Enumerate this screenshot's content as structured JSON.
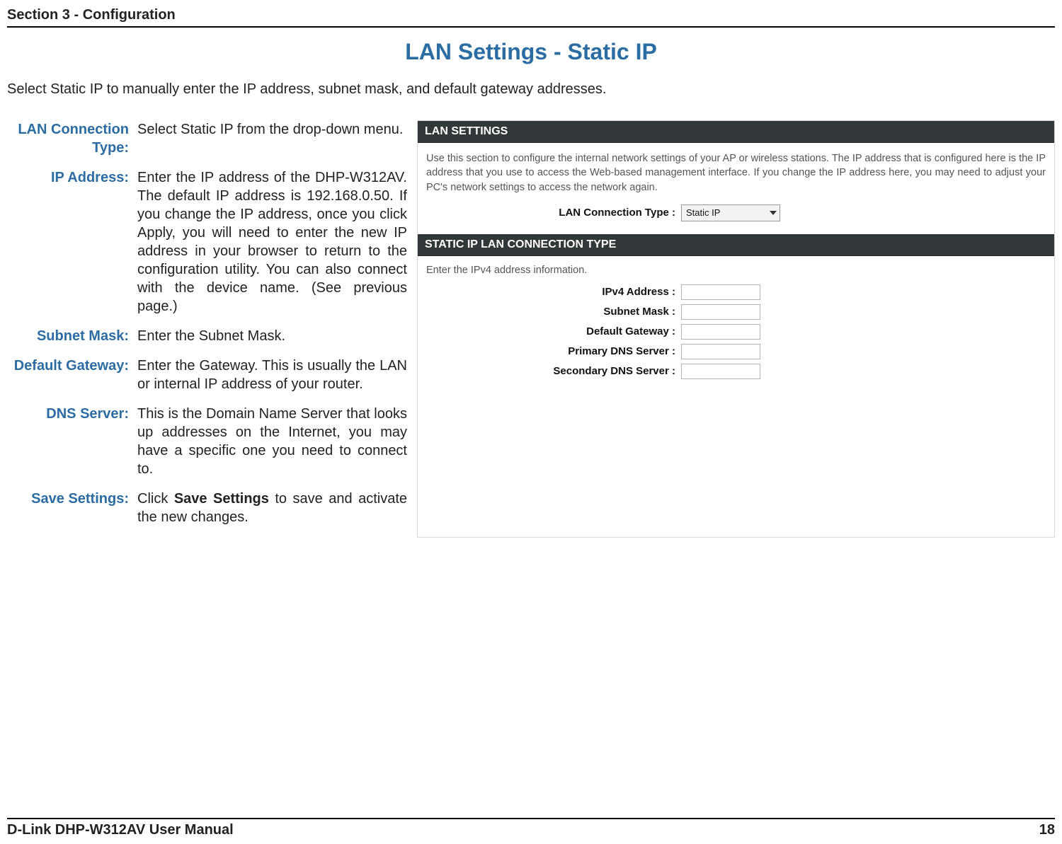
{
  "header": {
    "section": "Section 3 - Configuration"
  },
  "title": "LAN Settings - Static IP",
  "intro": "Select Static IP to manually enter the IP address, subnet mask, and default gateway addresses.",
  "defs": {
    "lan_type": {
      "label": "LAN Connection Type:",
      "body": "Select Static IP from the drop-down menu."
    },
    "ip": {
      "label": "IP Address:",
      "body": "Enter the IP address of the DHP-W312AV. The default IP address is 192.168.0.50. If you change the IP address, once you click Apply, you will need to enter the new IP address in your browser to return to the configuration utility. You can also connect with the device name. (See previous page.)"
    },
    "subnet": {
      "label": "Subnet Mask:",
      "body": "Enter the Subnet Mask."
    },
    "gateway": {
      "label": "Default Gateway:",
      "body": "Enter the Gateway. This is usually the LAN or internal IP address of your router."
    },
    "dns": {
      "label": "DNS Server:",
      "body": "This is the Domain Name Server that looks up addresses on the Internet, you may have a specific one you need to connect to."
    },
    "save": {
      "label": "Save Settings:",
      "body_pre": "Click ",
      "body_bold": "Save Settings",
      "body_post": " to save and activate the new changes."
    }
  },
  "screenshot": {
    "lan_panel": {
      "title": "LAN SETTINGS",
      "desc": "Use this section to configure the internal network settings of your AP or wireless stations. The IP address that is configured here is the IP address that you use to access the Web-based management interface. If you change the IP address here, you may need to adjust your PC's network settings to access the network again.",
      "conn_label": "LAN Connection Type :",
      "conn_value": "Static IP"
    },
    "static_panel": {
      "title": "STATIC IP LAN CONNECTION TYPE",
      "desc": "Enter the IPv4 address information.",
      "rows": {
        "ipv4": "IPv4 Address :",
        "subnet": "Subnet Mask :",
        "gateway": "Default Gateway :",
        "pdns": "Primary DNS Server :",
        "sdns": "Secondary DNS Server :"
      }
    }
  },
  "footer": {
    "left": "D-Link DHP-W312AV User Manual",
    "right": "18"
  }
}
